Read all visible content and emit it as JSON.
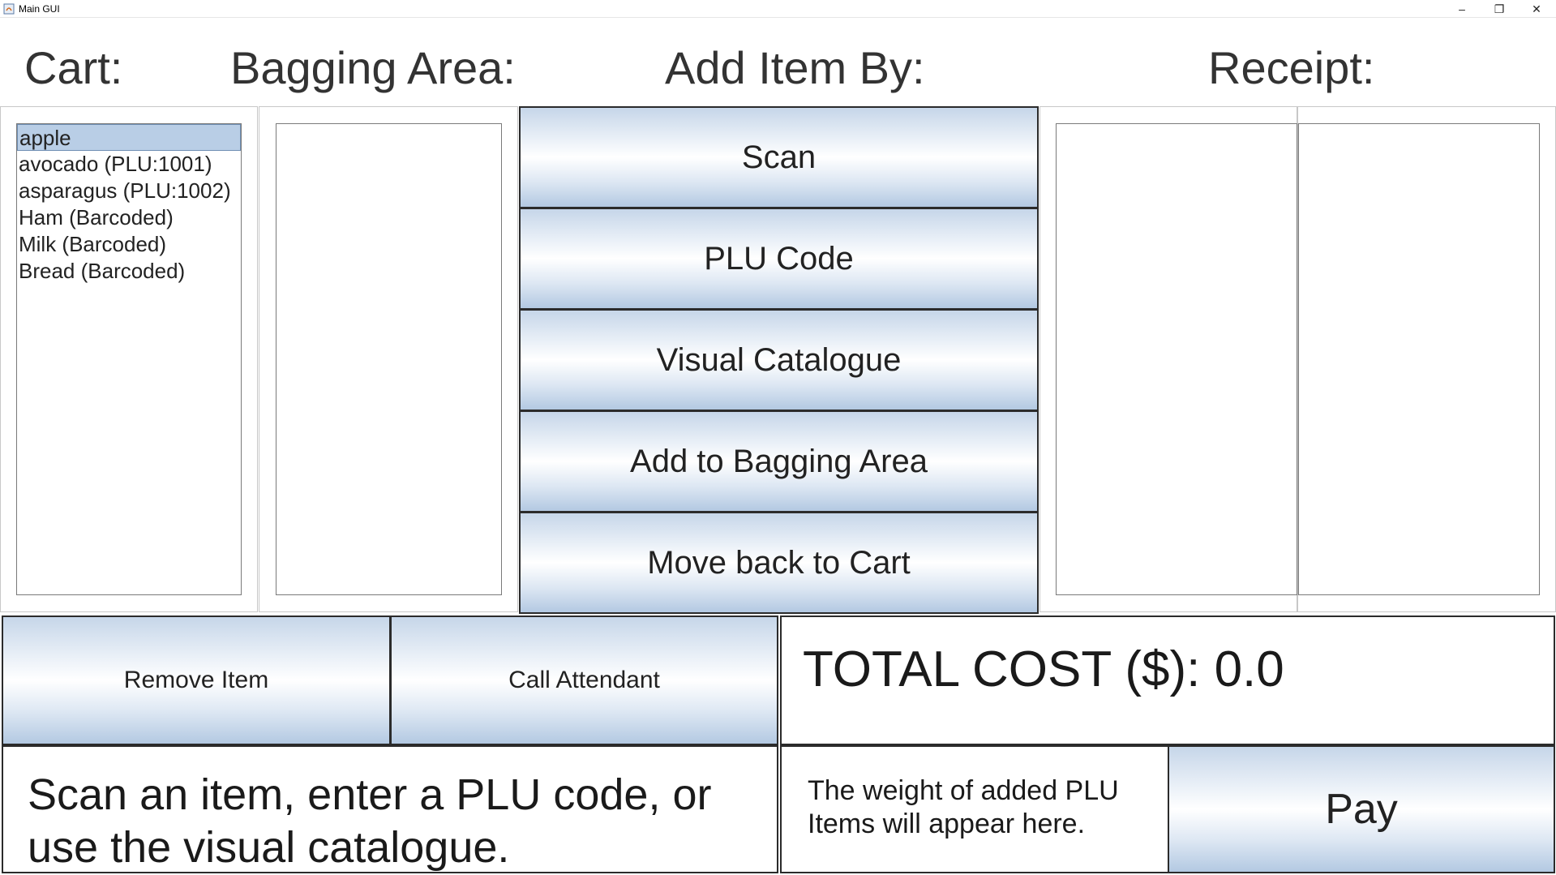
{
  "window": {
    "title": "Main GUI",
    "controls": {
      "minimize": "–",
      "maximize": "❐",
      "close": "✕"
    }
  },
  "headers": {
    "cart": "Cart:",
    "bagging": "Bagging Area:",
    "add_item": "Add Item By:",
    "receipt": "Receipt:"
  },
  "cart_list": {
    "items": [
      {
        "label": "apple",
        "selected": true
      },
      {
        "label": "avocado (PLU:1001)",
        "selected": false
      },
      {
        "label": "asparagus (PLU:1002)",
        "selected": false
      },
      {
        "label": "Ham (Barcoded)",
        "selected": false
      },
      {
        "label": "Milk (Barcoded)",
        "selected": false
      },
      {
        "label": "Bread (Barcoded)",
        "selected": false
      }
    ]
  },
  "add_buttons": {
    "scan": "Scan",
    "plu": "PLU Code",
    "visual": "Visual Catalogue",
    "add_bag": "Add to Bagging Area",
    "move_back": "Move back to Cart"
  },
  "actions": {
    "remove": "Remove Item",
    "attendant": "Call Attendant",
    "pay": "Pay"
  },
  "total": {
    "text": "TOTAL COST ($): 0.0"
  },
  "status": {
    "message": "Scan an item, enter a PLU code, or use the visual catalogue.",
    "weight": "The weight of added PLU Items will appear here."
  },
  "colors": {
    "selection": "#b9cee6",
    "button_gradient_edge": "#b3c9e2",
    "border": "#2b2b2b"
  }
}
